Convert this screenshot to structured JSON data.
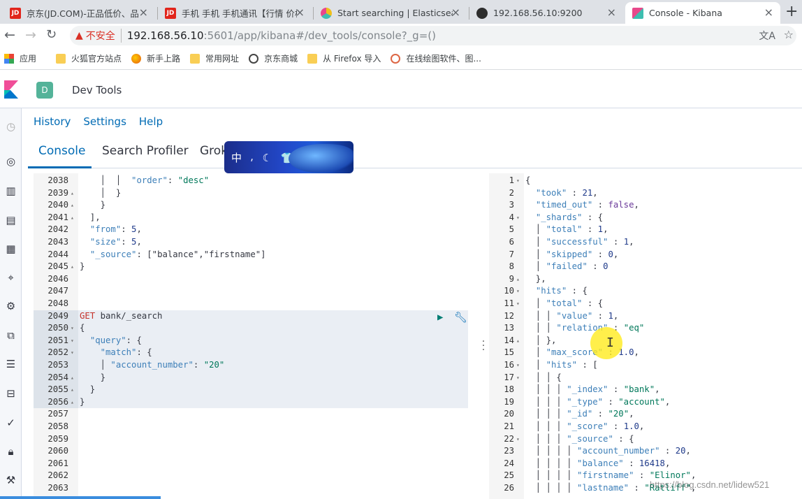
{
  "browser": {
    "tabs": [
      {
        "title": "京东(JD.COM)-正品低价、品质",
        "favicon": "JD",
        "color": "#e1251b"
      },
      {
        "title": "手机 手机 手机通讯【行情 价格",
        "favicon": "JD",
        "color": "#e1251b"
      },
      {
        "title": "Start searching | Elasticsearch",
        "favicon": "elastic",
        "color": "#f0bf1a"
      },
      {
        "title": "192.168.56.10:9200",
        "favicon": "globe",
        "color": "#2d2d2d"
      },
      {
        "title": "Console - Kibana",
        "favicon": "kibana",
        "color": "#e8488b"
      }
    ],
    "close_glyph": "×",
    "new_tab_glyph": "+",
    "address": {
      "warning_icon": "warning-icon",
      "insecure_label": "不安全",
      "url_host": "192.168.56.10",
      "url_rest": ":5601/app/kibana#/dev_tools/console?_g=()"
    },
    "bookmarks": [
      {
        "label": "应用",
        "icon": "apps-grid-icon"
      },
      {
        "label": "火狐官方站点",
        "icon": "folder-icon"
      },
      {
        "label": "新手上路",
        "icon": "firefox-icon"
      },
      {
        "label": "常用网址",
        "icon": "folder-icon"
      },
      {
        "label": "京东商城",
        "icon": "globe-icon"
      },
      {
        "label": "从 Firefox 导入",
        "icon": "folder-icon"
      },
      {
        "label": "在线绘图软件、图...",
        "icon": "circle-icon"
      }
    ]
  },
  "kibana": {
    "space_initial": "D",
    "breadcrumb": "Dev Tools",
    "menu": [
      "History",
      "Settings",
      "Help"
    ],
    "tabs": [
      "Console",
      "Search Profiler",
      "Grok"
    ],
    "active_tab": "Console",
    "widget_text": "中 ⸴ ☾ 👕"
  },
  "editor": {
    "lines": [
      {
        "n": "2038",
        "fold": "",
        "text": "    │  │  \"order\": \"desc\""
      },
      {
        "n": "2039",
        "fold": "▴",
        "text": "    │  }"
      },
      {
        "n": "2040",
        "fold": "▴",
        "text": "    }"
      },
      {
        "n": "2041",
        "fold": "▴",
        "text": "  ],"
      },
      {
        "n": "2042",
        "fold": "",
        "text": "  \"from\": 5,"
      },
      {
        "n": "2043",
        "fold": "",
        "text": "  \"size\": 5,"
      },
      {
        "n": "2044",
        "fold": "",
        "text": "  \"_source\": [\"balance\",\"firstname\"]"
      },
      {
        "n": "2045",
        "fold": "▴",
        "text": "}"
      },
      {
        "n": "2046",
        "fold": "",
        "text": ""
      },
      {
        "n": "2047",
        "fold": "",
        "text": ""
      },
      {
        "n": "2048",
        "fold": "",
        "text": ""
      },
      {
        "n": "2049",
        "fold": "",
        "text": "GET bank/_search"
      },
      {
        "n": "2050",
        "fold": "▾",
        "text": "{"
      },
      {
        "n": "2051",
        "fold": "▾",
        "text": "  \"query\": {"
      },
      {
        "n": "2052",
        "fold": "▾",
        "text": "    \"match\": {"
      },
      {
        "n": "2053",
        "fold": "",
        "text": "    │ \"account_number\": \"20\""
      },
      {
        "n": "2054",
        "fold": "▴",
        "text": "    }"
      },
      {
        "n": "2055",
        "fold": "▴",
        "text": "  }"
      },
      {
        "n": "2056",
        "fold": "▴",
        "text": "}"
      },
      {
        "n": "2057",
        "fold": "",
        "text": ""
      },
      {
        "n": "2058",
        "fold": "",
        "text": ""
      },
      {
        "n": "2059",
        "fold": "",
        "text": ""
      },
      {
        "n": "2060",
        "fold": "",
        "text": ""
      },
      {
        "n": "2061",
        "fold": "",
        "text": ""
      },
      {
        "n": "2062",
        "fold": "",
        "text": ""
      },
      {
        "n": "2063",
        "fold": "",
        "text": ""
      }
    ],
    "request_start": 11,
    "request_end": 18
  },
  "output": {
    "lines": [
      {
        "n": "1",
        "fold": "▾",
        "text": "{"
      },
      {
        "n": "2",
        "fold": "",
        "text": "  \"took\" : 21,"
      },
      {
        "n": "3",
        "fold": "",
        "text": "  \"timed_out\" : false,"
      },
      {
        "n": "4",
        "fold": "▾",
        "text": "  \"_shards\" : {"
      },
      {
        "n": "5",
        "fold": "",
        "text": "  │ \"total\" : 1,"
      },
      {
        "n": "6",
        "fold": "",
        "text": "  │ \"successful\" : 1,"
      },
      {
        "n": "7",
        "fold": "",
        "text": "  │ \"skipped\" : 0,"
      },
      {
        "n": "8",
        "fold": "",
        "text": "  │ \"failed\" : 0"
      },
      {
        "n": "9",
        "fold": "▴",
        "text": "  },"
      },
      {
        "n": "10",
        "fold": "▾",
        "text": "  \"hits\" : {"
      },
      {
        "n": "11",
        "fold": "▾",
        "text": "  │ \"total\" : {"
      },
      {
        "n": "12",
        "fold": "",
        "text": "  │ │ \"value\" : 1,"
      },
      {
        "n": "13",
        "fold": "",
        "text": "  │ │ \"relation\" : \"eq\""
      },
      {
        "n": "14",
        "fold": "▴",
        "text": "  │ },"
      },
      {
        "n": "15",
        "fold": "",
        "text": "  │ \"max_score\" : 1.0,"
      },
      {
        "n": "16",
        "fold": "▾",
        "text": "  │ \"hits\" : ["
      },
      {
        "n": "17",
        "fold": "▾",
        "text": "  │ │ {"
      },
      {
        "n": "18",
        "fold": "",
        "text": "  │ │ │ \"_index\" : \"bank\","
      },
      {
        "n": "19",
        "fold": "",
        "text": "  │ │ │ \"_type\" : \"account\","
      },
      {
        "n": "20",
        "fold": "",
        "text": "  │ │ │ \"_id\" : \"20\","
      },
      {
        "n": "21",
        "fold": "",
        "text": "  │ │ │ \"_score\" : 1.0,"
      },
      {
        "n": "22",
        "fold": "▾",
        "text": "  │ │ │ \"_source\" : {"
      },
      {
        "n": "23",
        "fold": "",
        "text": "  │ │ │ │ \"account_number\" : 20,"
      },
      {
        "n": "24",
        "fold": "",
        "text": "  │ │ │ │ \"balance\" : 16418,"
      },
      {
        "n": "25",
        "fold": "",
        "text": "  │ │ │ │ \"firstname\" : \"Elinor\","
      },
      {
        "n": "26",
        "fold": "",
        "text": "  │ │ │ │ \"lastname\" : \"Ratliff\","
      }
    ]
  },
  "watermark": "https://blog.csdn.net/lidew521"
}
